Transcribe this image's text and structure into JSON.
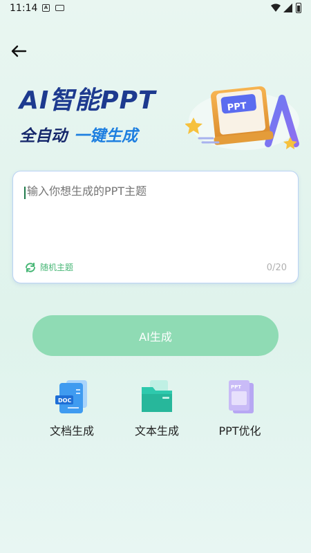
{
  "status_bar": {
    "time": "11:14",
    "app_icon_letter": "A"
  },
  "hero": {
    "title": "AI智能PPT",
    "subtitle_part1": "全自动",
    "subtitle_part2": "一键生成",
    "badge_text": "PPT"
  },
  "input": {
    "placeholder": "输入你想生成的PPT主题",
    "value": "",
    "random_label": "随机主题",
    "char_count": "0/20"
  },
  "generate_button": {
    "label": "AI生成"
  },
  "actions": [
    {
      "label": "文档生成",
      "icon": "doc-file-icon",
      "icon_text": "DOC"
    },
    {
      "label": "文本生成",
      "icon": "folder-icon"
    },
    {
      "label": "PPT优化",
      "icon": "ppt-file-icon",
      "icon_text": "PPT"
    }
  ],
  "colors": {
    "accent_green": "#8fdbb4",
    "title_blue": "#1d3a8f",
    "highlight_blue": "#1e7fe0",
    "random_green": "#46b675"
  }
}
